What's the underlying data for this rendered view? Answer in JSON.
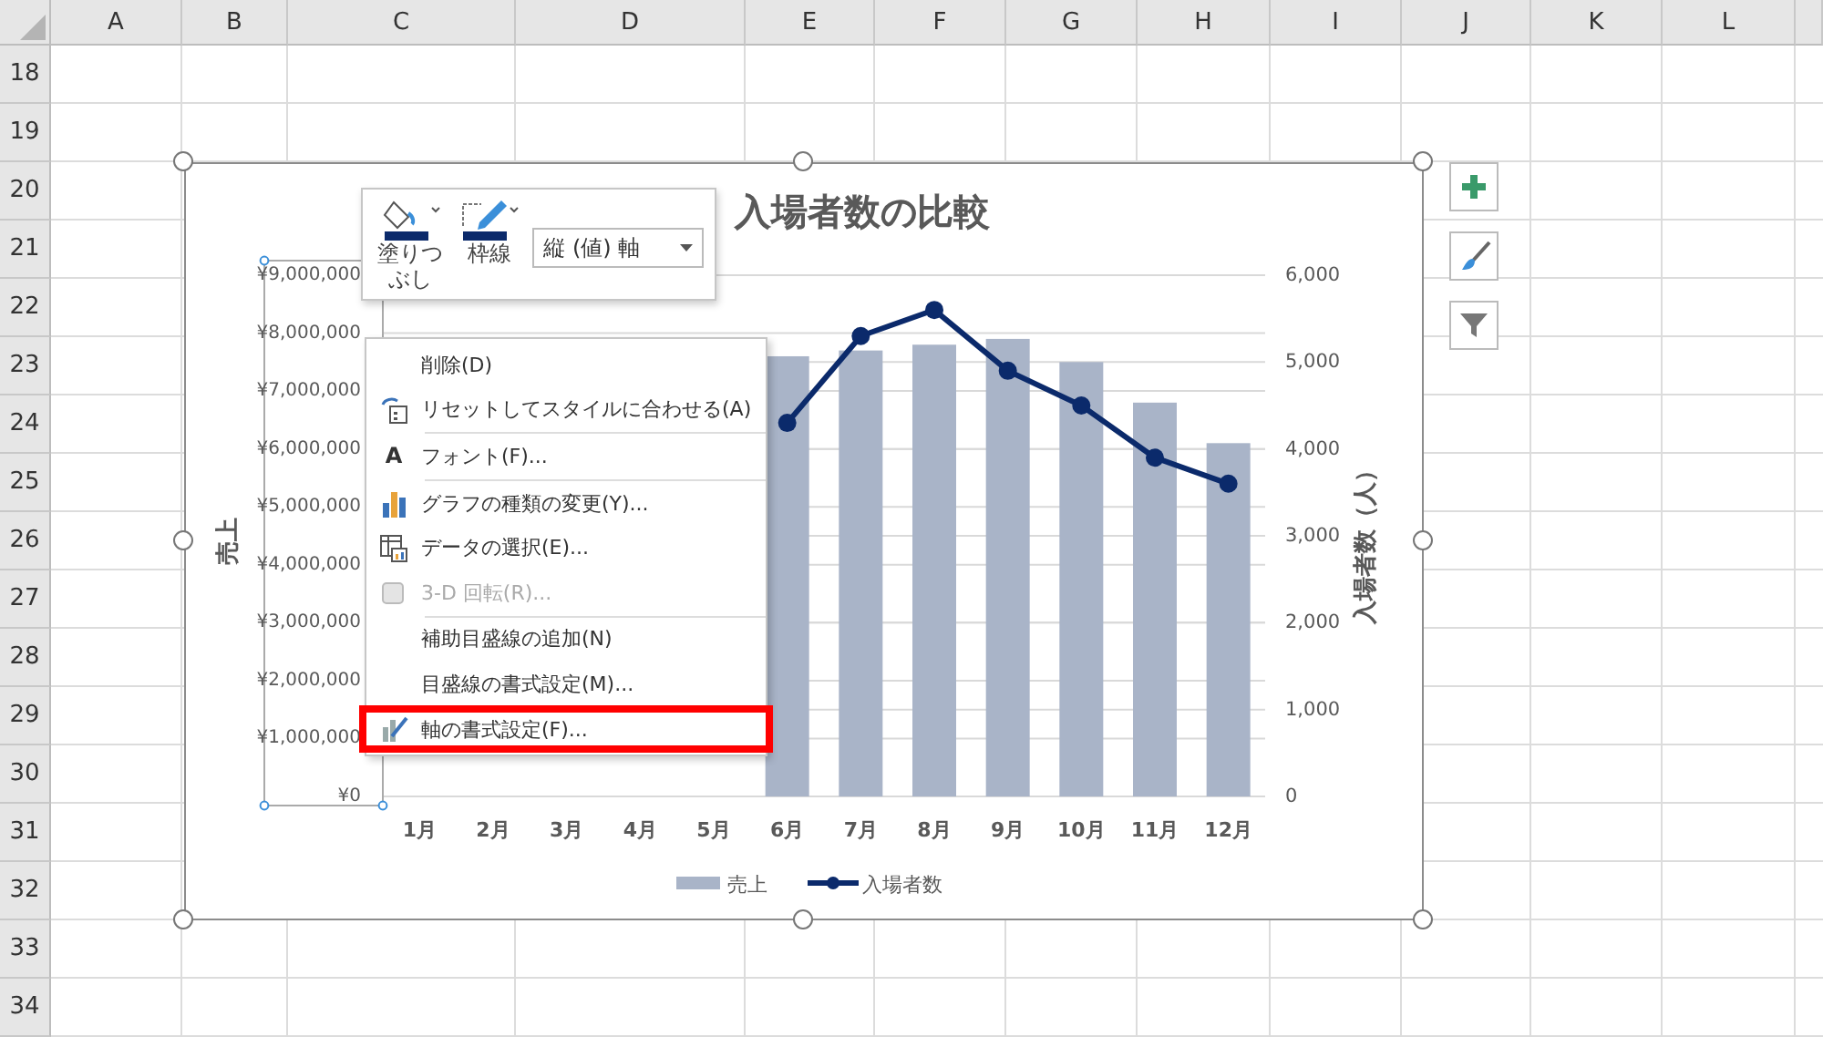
{
  "columns": [
    "A",
    "B",
    "C",
    "D",
    "E",
    "F",
    "G",
    "H",
    "I",
    "J",
    "K",
    "L"
  ],
  "rows": [
    "18",
    "19",
    "20",
    "21",
    "22",
    "23",
    "24",
    "25",
    "26",
    "27",
    "28",
    "29",
    "30",
    "31",
    "32",
    "33",
    "34"
  ],
  "chart": {
    "title": "入場者数の比較",
    "chart_data": {
      "type": "bar",
      "categories": [
        "1月",
        "2月",
        "3月",
        "4月",
        "5月",
        "6月",
        "7月",
        "8月",
        "9月",
        "10月",
        "11月",
        "12月"
      ],
      "series": [
        {
          "name": "売上",
          "type": "bar",
          "color": "#a9b4c8",
          "values": [
            null,
            null,
            null,
            null,
            null,
            7600000,
            7700000,
            7800000,
            7900000,
            7500000,
            6800000,
            6100000
          ]
        },
        {
          "name": "入場者数",
          "type": "line",
          "axis": "y2",
          "marker": true,
          "color": "#0b2a6b",
          "values": [
            null,
            null,
            null,
            null,
            null,
            4300,
            5300,
            5600,
            4900,
            4500,
            3900,
            3600
          ]
        }
      ],
      "grid": true,
      "legend": "bottom",
      "ylabel": "売上",
      "y2label": "入場者数（人）",
      "ylim": [
        0,
        9000000
      ],
      "y2lim": [
        0,
        6000
      ],
      "yticks": [
        {
          "value": 0,
          "label": "¥0"
        },
        {
          "value": 1000000,
          "label": "¥1,000,000"
        },
        {
          "value": 2000000,
          "label": "¥2,000,000"
        },
        {
          "value": 3000000,
          "label": "¥3,000,000"
        },
        {
          "value": 4000000,
          "label": "¥4,000,000"
        },
        {
          "value": 5000000,
          "label": "¥5,000,000"
        },
        {
          "value": 6000000,
          "label": "¥6,000,000"
        },
        {
          "value": 7000000,
          "label": "¥7,000,000"
        },
        {
          "value": 8000000,
          "label": "¥8,000,000"
        },
        {
          "value": 9000000,
          "label": "¥9,000,000"
        }
      ],
      "y2ticks": [
        {
          "value": 0,
          "label": "0"
        },
        {
          "value": 1000,
          "label": "1,000"
        },
        {
          "value": 2000,
          "label": "2,000"
        },
        {
          "value": 3000,
          "label": "3,000"
        },
        {
          "value": 4000,
          "label": "4,000"
        },
        {
          "value": 5000,
          "label": "5,000"
        },
        {
          "value": 6000,
          "label": "6,000"
        }
      ]
    }
  },
  "mini_toolbar": {
    "fill_label": "塗りつぶし",
    "outline_label": "枠線",
    "element_select": {
      "value": "縦 (値) 軸"
    }
  },
  "context_menu": [
    {
      "label": "削除(D)",
      "kind": "plain",
      "disabled": false,
      "selected": false
    },
    {
      "label": "リセットしてスタイルに合わせる(A)",
      "kind": "reset",
      "disabled": false,
      "selected": false
    },
    {
      "kind": "separator"
    },
    {
      "label": "フォント(F)...",
      "kind": "font",
      "glyph": "A",
      "disabled": false,
      "selected": false
    },
    {
      "kind": "separator"
    },
    {
      "label": "グラフの種類の変更(Y)...",
      "kind": "chart",
      "disabled": false,
      "selected": false
    },
    {
      "label": "データの選択(E)...",
      "kind": "data",
      "disabled": false,
      "selected": false
    },
    {
      "label": "3-D 回転(R)...",
      "kind": "cube",
      "disabled": true,
      "selected": false
    },
    {
      "kind": "separator"
    },
    {
      "label": "補助目盛線の追加(N)",
      "kind": "plain",
      "disabled": false,
      "selected": false
    },
    {
      "label": "目盛線の書式設定(M)...",
      "kind": "plain",
      "disabled": false,
      "selected": false
    },
    {
      "label": "軸の書式設定(F)...",
      "kind": "axis",
      "disabled": false,
      "selected": true
    }
  ]
}
